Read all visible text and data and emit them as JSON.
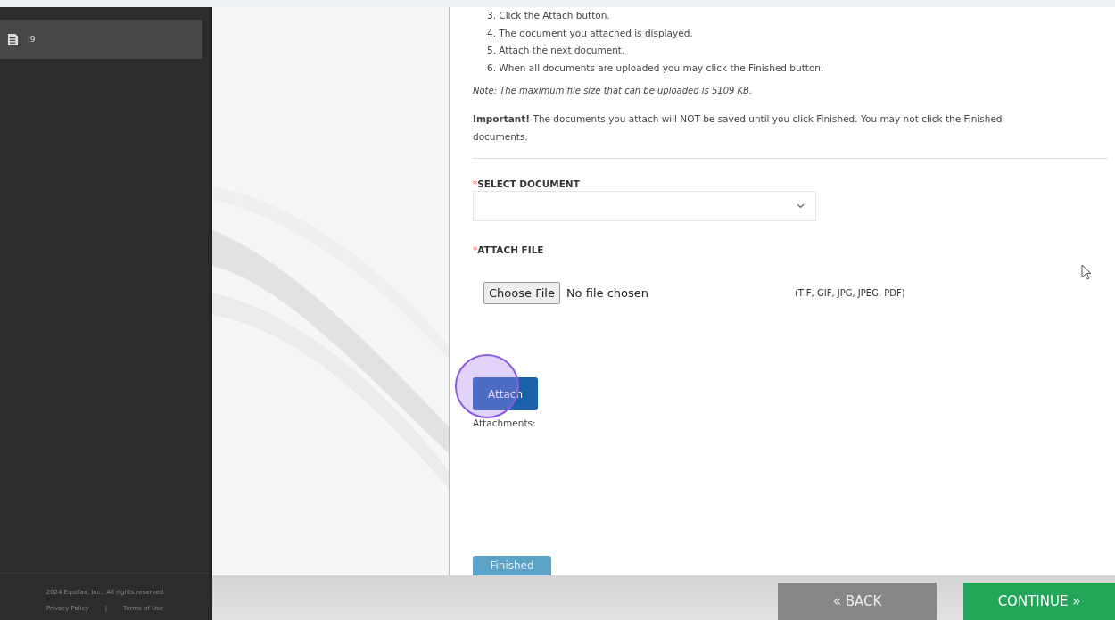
{
  "sidebar": {
    "items": [
      {
        "label": "I9",
        "selected": true
      }
    ],
    "footer": {
      "copyright": "2024 Equifax, Inc., All rights reserved",
      "links": [
        "Privacy Policy",
        "Terms of Use"
      ],
      "separator": "|"
    }
  },
  "instructions": [
    "3. Click the Attach button.",
    "4. The document you attached is displayed.",
    "5. Attach the next document.",
    "6. When all documents are uploaded you may click the Finished button."
  ],
  "note": "Note: The maximum file size that can be uploaded is 5109 KB.",
  "important": "**Important!** The documents you attach will NOT be saved until you click Finished. You may not click the Finished",
  "important_cont": "documents.",
  "select_document": {
    "label": "SELECT DOCUMENT",
    "required_mark": "*"
  },
  "attach_file": {
    "label": "ATTACH FILE",
    "required_mark": "*",
    "choose_button": "Choose File",
    "status": "No file chosen",
    "formats": "(TIF, GIF, JPG, JPEG, PDF)"
  },
  "attach_button": "Attach",
  "attachments_label": "Attachments:",
  "finished_button": {
    "label": "Finished",
    "disabled": true
  },
  "nav": {
    "back": "« BACK",
    "continue": "CONTINUE »"
  }
}
